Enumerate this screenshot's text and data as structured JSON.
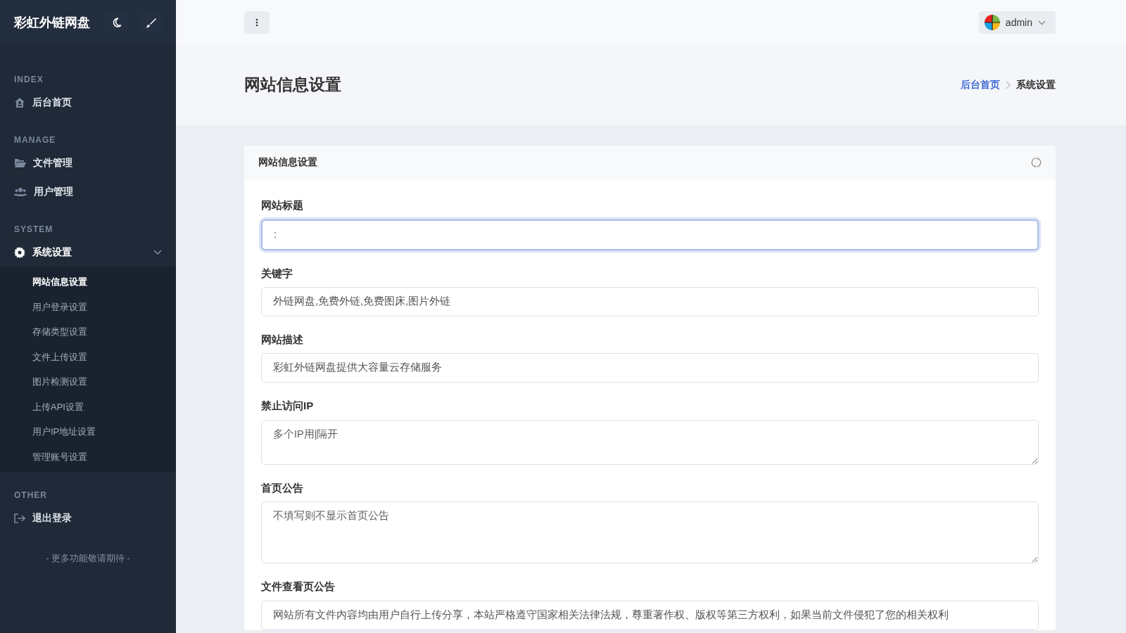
{
  "sidebar": {
    "brand": "彩虹外链网盘",
    "sections": [
      {
        "heading": "INDEX",
        "items": [
          {
            "label": "后台首页",
            "kind": "home",
            "selected": false
          }
        ]
      },
      {
        "heading": "MANAGE",
        "items": [
          {
            "label": "文件管理",
            "kind": "folder",
            "selected": false
          },
          {
            "label": "用户管理",
            "kind": "users",
            "selected": false
          }
        ]
      },
      {
        "heading": "SYSTEM",
        "items": [
          {
            "label": "系统设置",
            "kind": "gear",
            "selected": true,
            "expanded": true,
            "children": [
              {
                "label": "网站信息设置",
                "selected": true
              },
              {
                "label": "用户登录设置",
                "selected": false
              },
              {
                "label": "存储类型设置",
                "selected": false
              },
              {
                "label": "文件上传设置",
                "selected": false
              },
              {
                "label": "图片检测设置",
                "selected": false
              },
              {
                "label": "上传API设置",
                "selected": false
              },
              {
                "label": "用户IP地址设置",
                "selected": false
              },
              {
                "label": "管理账号设置",
                "selected": false
              }
            ]
          }
        ]
      },
      {
        "heading": "OTHER",
        "items": [
          {
            "label": "退出登录",
            "kind": "logout",
            "selected": false
          }
        ]
      }
    ],
    "footer": "- 更多功能敬请期待 -"
  },
  "topbar": {
    "user": "admin"
  },
  "page_title": "网站信息设置",
  "breadcrumb": [
    {
      "label": "后台首页",
      "kind": "link"
    },
    {
      "label": "系统设置",
      "kind": "current"
    }
  ],
  "card": {
    "title": "网站信息设置",
    "fields": [
      {
        "label": "网站标题",
        "kind": "input",
        "value": ":",
        "focused": true
      },
      {
        "label": "关键字",
        "kind": "input",
        "value": "外链网盘,免费外链,免费图床,图片外链",
        "focused": false
      },
      {
        "label": "网站描述",
        "kind": "input",
        "value": "彩虹外链网盘提供大容量云存储服务",
        "focused": false
      },
      {
        "label": "禁止访问IP",
        "kind": "textarea",
        "placeholder": "多个IP用|隔开",
        "focused": false
      },
      {
        "label": "首页公告",
        "kind": "textarea",
        "placeholder": "不填写则不显示首页公告",
        "focused": false
      },
      {
        "label": "文件查看页公告",
        "kind": "textarea",
        "value": "网站所有文件内容均由用户自行上传分享，本站严格遵守国家相关法律法规，尊重著作权、版权等第三方权利，如果当前文件侵犯了您的相关权利",
        "focused": false
      }
    ]
  }
}
